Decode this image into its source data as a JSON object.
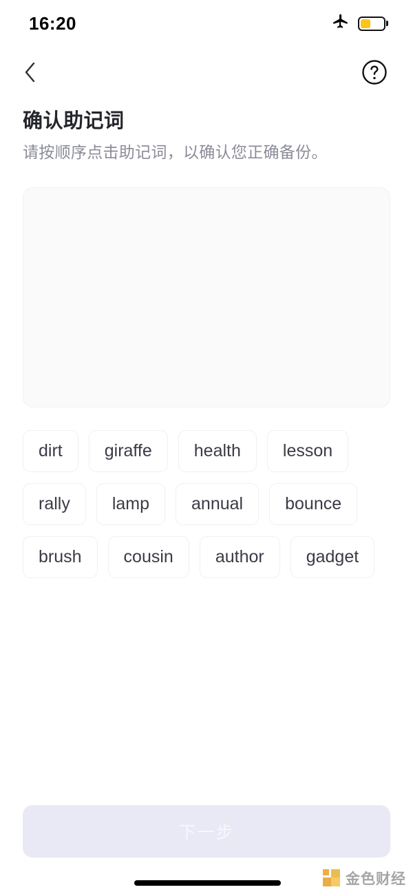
{
  "status_bar": {
    "time": "16:20",
    "airplane_icon": "airplane-mode-icon",
    "battery_icon": "battery-low-power-icon",
    "battery_level_percent": 40,
    "battery_color": "#fcc419"
  },
  "nav": {
    "back_icon": "chevron-left-icon",
    "help_icon": "question-mark-circle-icon"
  },
  "header": {
    "title": "确认助记词",
    "subtitle": "请按顺序点击助记词，以确认您正确备份。"
  },
  "answer_area": {
    "selected_words": [],
    "background_color": "#fafafa"
  },
  "word_pool": {
    "words": [
      "dirt",
      "giraffe",
      "health",
      "lesson",
      "rally",
      "lamp",
      "annual",
      "bounce",
      "brush",
      "cousin",
      "author",
      "gadget"
    ]
  },
  "footer": {
    "next_label": "下一步",
    "next_disabled": true,
    "next_bg_color": "#e9e9f5"
  },
  "watermark": {
    "text": "金色财经",
    "logo_color": "#e8a22c"
  }
}
